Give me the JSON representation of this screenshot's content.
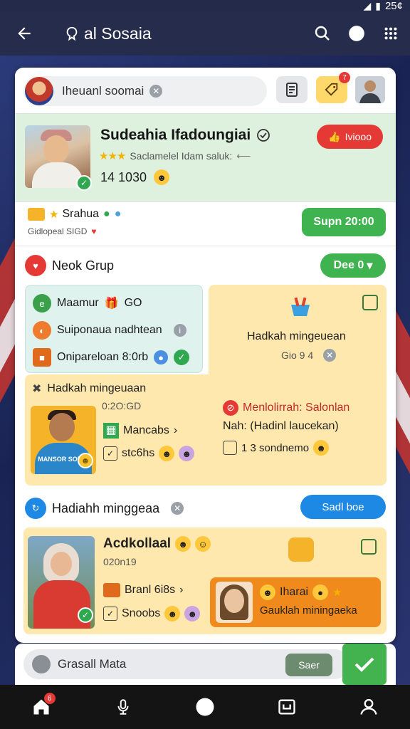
{
  "status": {
    "time": "25¢"
  },
  "topbar": {
    "title": "al Sosaia"
  },
  "search": {
    "text": "Iheuanl soomai"
  },
  "header_badge": "7",
  "profile": {
    "name": "Sudeahia Ifadoungiai",
    "subtitle": "Saclamelel Idam saluk:",
    "count": "14 1030",
    "follow_label": "Iviooo"
  },
  "rank": {
    "label": "Srahua",
    "sublabel": "Gidlopeal SIGD",
    "button": "Supn 20:00"
  },
  "group": {
    "title": "Neok Grup",
    "see_button": "Dee 0"
  },
  "mint_tile": {
    "row1": "Maamur",
    "row1_suffix": "GO",
    "row2": "Suiponaua nadhtean",
    "row3": "Onipareloan 8:0rb"
  },
  "yellow_tile": {
    "title": "Hadkah mingeuean",
    "sub": "Gio 9 4"
  },
  "wide_tile": {
    "title": "Hadkah mingeuaan",
    "date": "0:2O:GD",
    "mid_label": "Mancabs",
    "count_label": "stc6hs",
    "right_title": "Menlolirrah: Salonlan",
    "right_sub": "Nah: (Hadinl laucekan)",
    "right_count": "1 3 sondnemo",
    "shirt_text": "MANSOR SOIHO"
  },
  "group2": {
    "title": "Hadiahh minggeaa",
    "button": "Sadl boe"
  },
  "tile3": {
    "title": "Acdkollaal",
    "date": "020n19",
    "row1": "Branl 6i8s",
    "row2": "Snoobs",
    "orange_line1": "Iharai",
    "orange_line2": "Gauklah miningaeka"
  },
  "sheet": {
    "placeholder": "Grasall Mata",
    "button": "Saer"
  },
  "nav": {
    "home_badge": "6"
  },
  "colors": {
    "accent_green": "#3fb34f",
    "accent_red": "#e53935",
    "accent_blue": "#1e88e5",
    "panel_yellow": "#ffe8ad",
    "panel_mint": "#dff2ee"
  }
}
